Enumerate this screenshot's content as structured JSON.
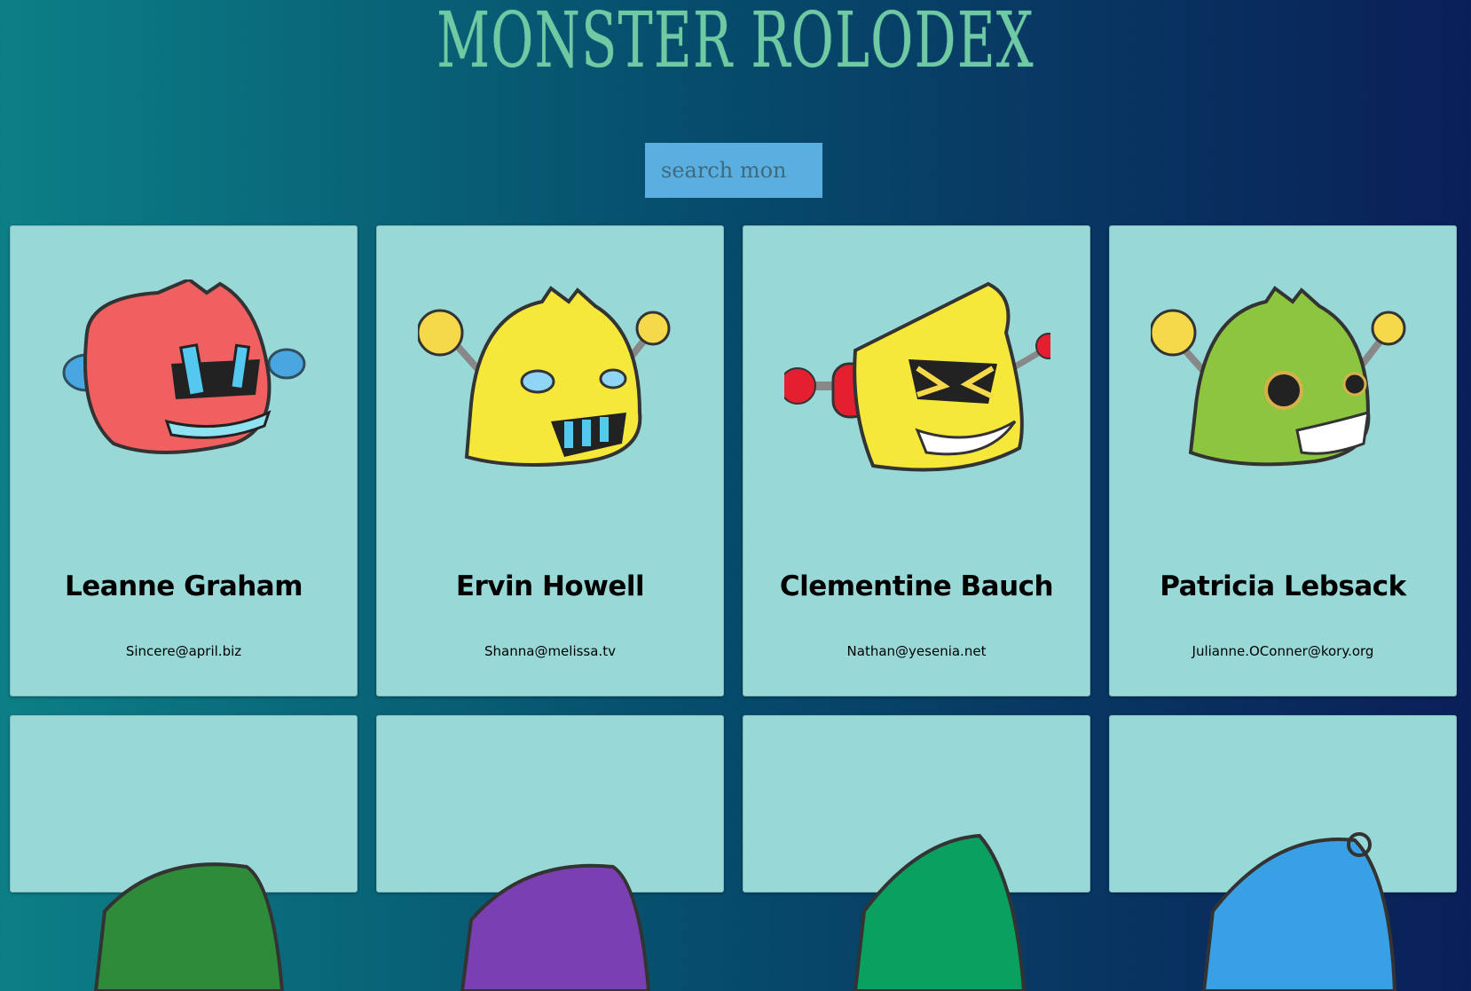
{
  "header": {
    "title": "MONSTER ROLODEX"
  },
  "search": {
    "placeholder": "search monster",
    "value": ""
  },
  "monsters": [
    {
      "name": "Leanne Graham",
      "email": "Sincere@april.biz",
      "color": "#f06060"
    },
    {
      "name": "Ervin Howell",
      "email": "Shanna@melissa.tv",
      "color": "#f5e83a"
    },
    {
      "name": "Clementine Bauch",
      "email": "Nathan@yesenia.net",
      "color": "#f5e83a"
    },
    {
      "name": "Patricia Lebsack",
      "email": "Julianne.OConner@kory.org",
      "color": "#8cc63f"
    },
    {
      "color": "#2e8b3a"
    },
    {
      "color": "#7a3fb0"
    },
    {
      "color": "#0aa060"
    },
    {
      "color": "#3aa0e6"
    }
  ]
}
